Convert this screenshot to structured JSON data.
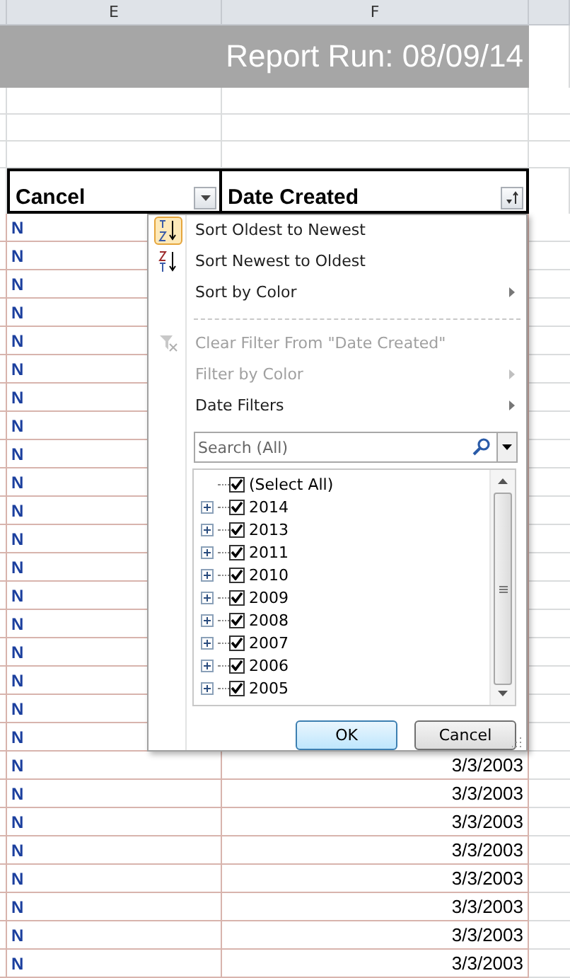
{
  "column_headers": [
    {
      "label": "E"
    },
    {
      "label": "F"
    }
  ],
  "report_title": "Report Run: 08/09/14",
  "table": {
    "columns": [
      {
        "label": "Cancel",
        "filtered": false
      },
      {
        "label": "Date Created",
        "filtered": true
      }
    ],
    "rows": [
      {
        "cancel": "N"
      },
      {
        "cancel": "N"
      },
      {
        "cancel": "N"
      },
      {
        "cancel": "N"
      },
      {
        "cancel": "N"
      },
      {
        "cancel": "N"
      },
      {
        "cancel": "N"
      },
      {
        "cancel": "N"
      },
      {
        "cancel": "N"
      },
      {
        "cancel": "N"
      },
      {
        "cancel": "N"
      },
      {
        "cancel": "N"
      },
      {
        "cancel": "N"
      },
      {
        "cancel": "N"
      },
      {
        "cancel": "N"
      },
      {
        "cancel": "N"
      },
      {
        "cancel": "N"
      },
      {
        "cancel": "N"
      },
      {
        "cancel": "N"
      },
      {
        "cancel": "N",
        "date": "3/3/2003"
      },
      {
        "cancel": "N",
        "date": "3/3/2003"
      },
      {
        "cancel": "N",
        "date": "3/3/2003"
      },
      {
        "cancel": "N",
        "date": "3/3/2003"
      },
      {
        "cancel": "N",
        "date": "3/3/2003"
      },
      {
        "cancel": "N",
        "date": "3/3/2003"
      },
      {
        "cancel": "N",
        "date": "3/3/2003"
      },
      {
        "cancel": "N",
        "date": "3/3/2003"
      }
    ]
  },
  "filter_menu": {
    "items": [
      {
        "kind": "sort_asc",
        "label": "Sort Oldest to Newest",
        "disabled": false,
        "selected": true
      },
      {
        "kind": "sort_desc",
        "label": "Sort Newest to Oldest",
        "disabled": false,
        "selected": false
      },
      {
        "kind": "submenu",
        "label": "Sort by Color",
        "disabled": false,
        "selected": false
      },
      {
        "kind": "separator"
      },
      {
        "kind": "clear",
        "label": "Clear Filter From \"Date Created\"",
        "disabled": true,
        "selected": false
      },
      {
        "kind": "submenu",
        "label": "Filter by Color",
        "disabled": true,
        "selected": false
      },
      {
        "kind": "submenu",
        "label": "Date Filters",
        "disabled": false,
        "selected": false
      }
    ],
    "search": {
      "placeholder": "Search (All)"
    },
    "tree": [
      {
        "label": "(Select All)",
        "checked": true,
        "expandable": false
      },
      {
        "label": "2014",
        "checked": true,
        "expandable": true
      },
      {
        "label": "2013",
        "checked": true,
        "expandable": true
      },
      {
        "label": "2011",
        "checked": true,
        "expandable": true
      },
      {
        "label": "2010",
        "checked": true,
        "expandable": true
      },
      {
        "label": "2009",
        "checked": true,
        "expandable": true
      },
      {
        "label": "2008",
        "checked": true,
        "expandable": true
      },
      {
        "label": "2007",
        "checked": true,
        "expandable": true
      },
      {
        "label": "2006",
        "checked": true,
        "expandable": true
      },
      {
        "label": "2005",
        "checked": true,
        "expandable": true
      }
    ],
    "buttons": [
      {
        "label": "OK",
        "default": true
      },
      {
        "label": "Cancel",
        "default": false
      }
    ]
  }
}
